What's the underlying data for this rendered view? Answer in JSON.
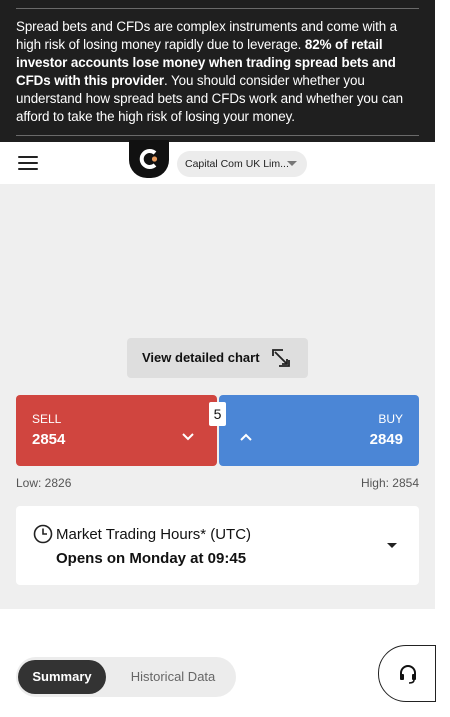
{
  "risk_warning": {
    "text_start": "Spread bets and CFDs are complex instruments and come with a high risk of losing money rapidly due to leverage. ",
    "text_bold": "82% of retail investor accounts lose money when trading spread bets and CFDs with this provider",
    "text_end": ". You should consider whether you understand how spread bets and CFDs work and whether you can afford to take the high risk of losing your money."
  },
  "header": {
    "menu_icon": "hamburger-menu-icon",
    "logo_icon": "capital-com-logo",
    "entity_selected": "Capital Com UK Lim..."
  },
  "chart": {
    "view_button_label": "View detailed chart",
    "expand_icon": "expand-icon"
  },
  "trade": {
    "sell_label": "SELL",
    "sell_price": "2854",
    "buy_label": "BUY",
    "buy_price": "2849",
    "spread": "5",
    "low": "Low: 2826",
    "high": "High: 2854",
    "colors": {
      "sell": "#d0453f",
      "buy": "#4b86d6"
    }
  },
  "hours": {
    "title": "Market Trading Hours* (UTC)",
    "subtitle": "Opens on Monday at 09:45"
  },
  "tabs": [
    {
      "label": "Summary",
      "active": true
    },
    {
      "label": "Historical Data",
      "active": false
    }
  ],
  "support": {
    "icon": "headset-icon"
  }
}
